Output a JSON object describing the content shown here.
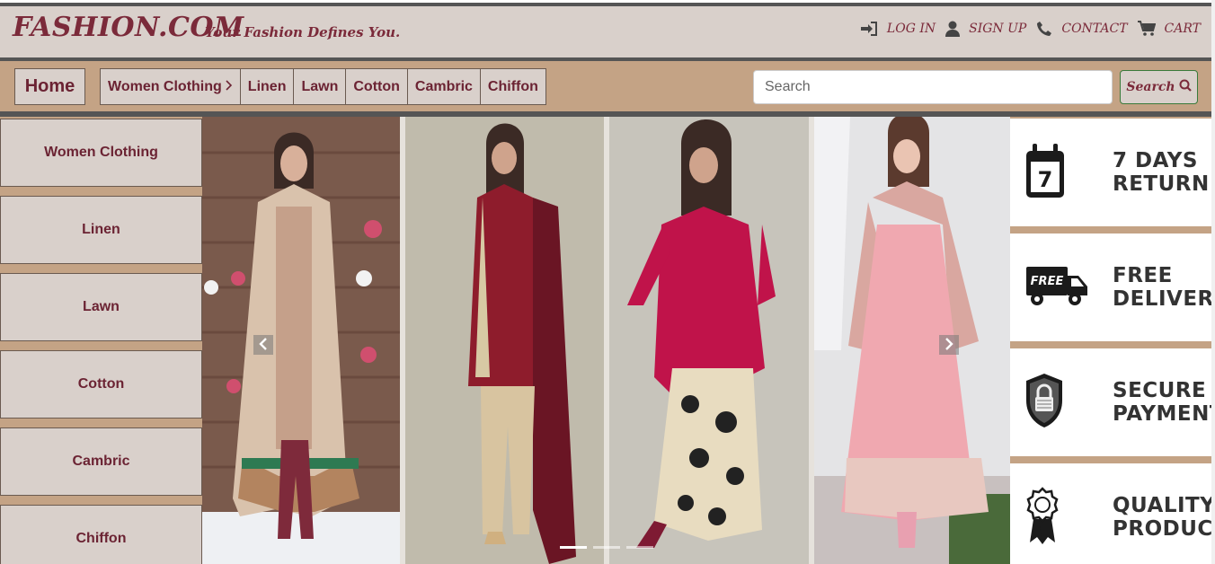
{
  "header": {
    "brand": "FASHION.COM",
    "tagline": "Your Fashion Defines You.",
    "links": [
      {
        "label": "LOG IN",
        "icon": "sign-in-icon"
      },
      {
        "label": "SIGN UP",
        "icon": "user-icon"
      },
      {
        "label": "CONTACT",
        "icon": "phone-icon"
      },
      {
        "label": "CART",
        "icon": "cart-icon"
      }
    ]
  },
  "nav": {
    "home": "Home",
    "categories": [
      "Women Clothing",
      "Linen",
      "Lawn",
      "Cotton",
      "Cambric",
      "Chiffon"
    ],
    "search_placeholder": "Search",
    "search_button": "Search"
  },
  "sidebar": {
    "items": [
      "Women Clothing",
      "Linen",
      "Lawn",
      "Cotton",
      "Cambric",
      "Chiffon"
    ]
  },
  "carousel": {
    "slides": [
      {
        "name": "beige-embroidered-outfit"
      },
      {
        "name": "maroon-outfit-with-dupatta"
      },
      {
        "name": "pink-lace-kurta"
      },
      {
        "name": "pink-anarkali"
      }
    ],
    "indicators": 3,
    "active_indicator": 1
  },
  "features": [
    {
      "label": "7 DAYS\nRETURN",
      "icon": "calendar-icon",
      "badge": "7"
    },
    {
      "label": "FREE\nDELIVERY",
      "icon": "delivery-truck-icon",
      "badge": "FREE"
    },
    {
      "label": "SECURE\nPAYMENT",
      "icon": "shield-lock-icon"
    },
    {
      "label": "QUALITY\nPRODUCT",
      "icon": "award-ribbon-icon"
    }
  ],
  "colors": {
    "brand": "#7b2a3a",
    "header_bg": "#d9d0cb",
    "nav_bg": "#c4a385",
    "separator": "#555555"
  }
}
